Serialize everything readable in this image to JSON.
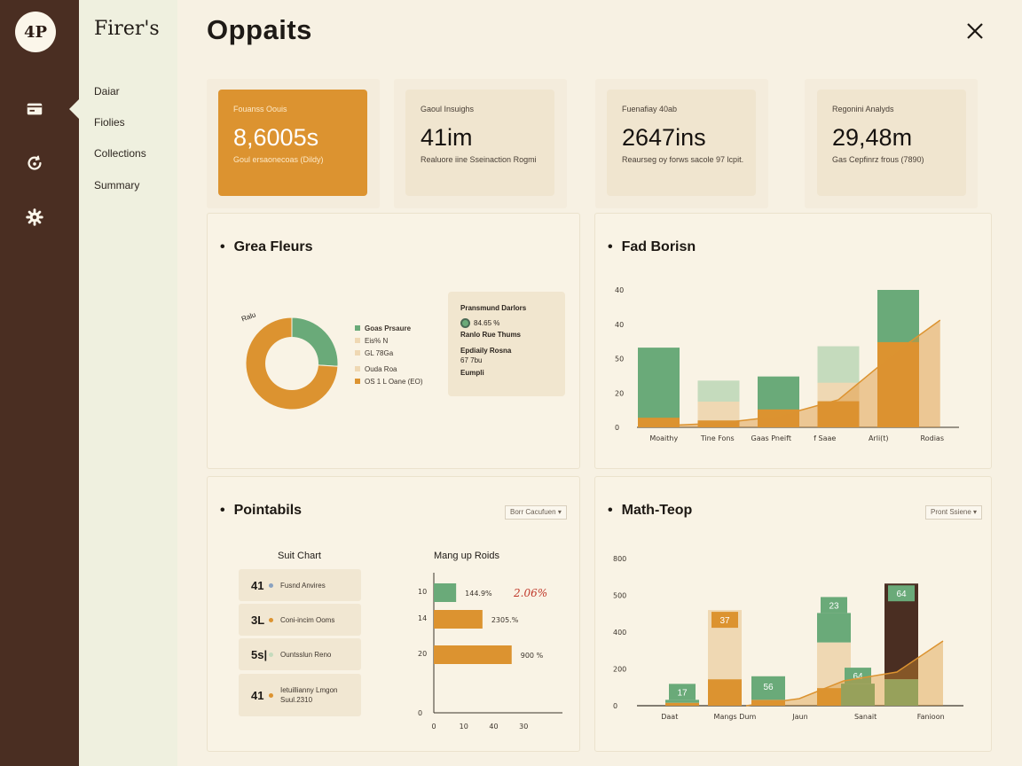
{
  "rail": {
    "logo": "4P",
    "icons": [
      "card-icon",
      "refresh-icon",
      "gear-icon"
    ]
  },
  "sidebar": {
    "brand": "Firer's",
    "items": [
      {
        "label": "Daiar"
      },
      {
        "label": "Fiolies"
      },
      {
        "label": "Collections"
      },
      {
        "label": "Summary"
      }
    ]
  },
  "header": {
    "title": "Oppaits"
  },
  "kpis": [
    {
      "label": "Fouanss Oouis",
      "value": "8,6005s",
      "sub": "Goul ersaonecoas (Dildy)",
      "active": true
    },
    {
      "label": "Gaoul Insuighs",
      "value": "41im",
      "sub": "Realuore iine Sseinaction Rogmi",
      "active": false
    },
    {
      "label": "Fuenafiay 40ab",
      "value": "2647ins",
      "sub": "Reaurseg oy forws sacole 97 lcpit.",
      "active": false
    },
    {
      "label": "Regonini Analyds",
      "value": "29,48m",
      "sub": "Gas Cepfinrz frous (7890)",
      "active": false
    }
  ],
  "colors": {
    "orange": "#dc9330",
    "green": "#6aaa79",
    "light_green": "#c5dbbd",
    "beige": "#efd8b3",
    "brown": "#4a2e22"
  },
  "panels": {
    "donut": {
      "title": "Grea Fleurs",
      "corner_label": "Ralu",
      "legend": [
        {
          "label": "Goas Prsaure",
          "color": "#6aaa79"
        },
        {
          "label": "Eis% N",
          "color": "#efd8b3"
        },
        {
          "label": "GL 78Ga",
          "color": "#efd8b3"
        },
        {
          "label": "Ouda Roa",
          "color": "#efd8b3"
        },
        {
          "label": "OS 1 L Oane (EO)",
          "color": "#dc9330"
        }
      ],
      "info": {
        "heading": "Pransmund Darlors",
        "pct": "84.65 %",
        "line2": "Ranlo Rue Thums",
        "line3": "Epdiaily Rosna",
        "line4": "67 7bu",
        "line5": "Eumpli"
      }
    },
    "bars": {
      "title": "Fad Borisn"
    },
    "pointabils": {
      "title": "Pointabils",
      "dropdown": "Borr Cacufuen",
      "left_title": "Suit Chart",
      "right_title": "Mang up Roids",
      "rows": [
        {
          "num": "41",
          "label": "Fusnd Anvires",
          "color": "#8aa2c0"
        },
        {
          "num": "3L",
          "label": "Coni-incim Ooms",
          "color": "#dc9330"
        },
        {
          "num": "5s|",
          "label": "Ountsslun Reno",
          "color": "#c5dbbd"
        },
        {
          "num": "41",
          "label": "Ietuillianny Lmgon Suul.2310",
          "color": "#dc9330"
        }
      ]
    },
    "stacked": {
      "title": "Math-Teop",
      "dropdown": "Pront Ssiene"
    }
  },
  "chart_data": [
    {
      "type": "pie",
      "title": "Grea Fleurs",
      "labels": [
        "Goas Prsaure",
        "OS 1 L Oane (EO)"
      ],
      "values": [
        26,
        74
      ]
    },
    {
      "type": "bar",
      "title": "Fad Borisn",
      "categories": [
        "Moaithy",
        "Tine Fons",
        "Gaas Pneift",
        "f Saae",
        "Arli(t)",
        "Rodias"
      ],
      "y_ticks": [
        "0",
        "20",
        "50",
        "40",
        "40"
      ],
      "ylim": [
        0,
        100
      ],
      "series": [
        {
          "color": "#6aaa79",
          "values": [
            58,
            null,
            37,
            26,
            100,
            null
          ]
        },
        {
          "color": "#efd8b3",
          "values": [
            null,
            34,
            null,
            59,
            null,
            null
          ]
        },
        {
          "color": "#dc9330",
          "values": [
            7,
            5,
            13,
            19,
            62,
            null
          ]
        }
      ],
      "trend": [
        [
          0,
          1
        ],
        [
          1,
          3
        ],
        [
          2,
          8
        ],
        [
          3,
          20
        ],
        [
          4,
          56
        ],
        [
          4.7,
          78
        ]
      ]
    },
    {
      "type": "bar",
      "title": "Mang up Roids",
      "orientation": "horizontal",
      "categories": [
        "10",
        "14",
        "20"
      ],
      "values": [
        14.9,
        32.5,
        52
      ],
      "value_labels": [
        "144.9%",
        "2305.%",
        "900 %"
      ],
      "extra_label": "2.06%",
      "x_ticks": [
        "0",
        "10",
        "40",
        "30"
      ],
      "xlim": [
        0,
        80
      ]
    },
    {
      "type": "bar",
      "title": "Math-Teop",
      "categories": [
        "Daat",
        "Mangs Dum",
        "Jaun",
        "Sanait",
        "Fanioon"
      ],
      "y_ticks": [
        "0",
        "200",
        "400",
        "500",
        "800"
      ],
      "ylim": [
        0,
        1000
      ],
      "stacks": [
        {
          "x": 0.4,
          "green": 20,
          "beige": 0,
          "orange": 20,
          "label": "17"
        },
        {
          "x": 1.3,
          "green": 0,
          "beige": 470,
          "orange": 180,
          "label": "37"
        },
        {
          "x": 2.2,
          "green": 160,
          "beige": 0,
          "orange": 40,
          "label": "56"
        },
        {
          "x": 3.1,
          "green": 200,
          "beige": 310,
          "orange": 120,
          "label": "23"
        },
        {
          "x": 3.4,
          "green": 150,
          "beige": 0,
          "orange": 0,
          "label": "64"
        },
        {
          "x": 4.0,
          "green": 180,
          "brown": 650,
          "orange": 0,
          "label": "64"
        }
      ]
    }
  ]
}
